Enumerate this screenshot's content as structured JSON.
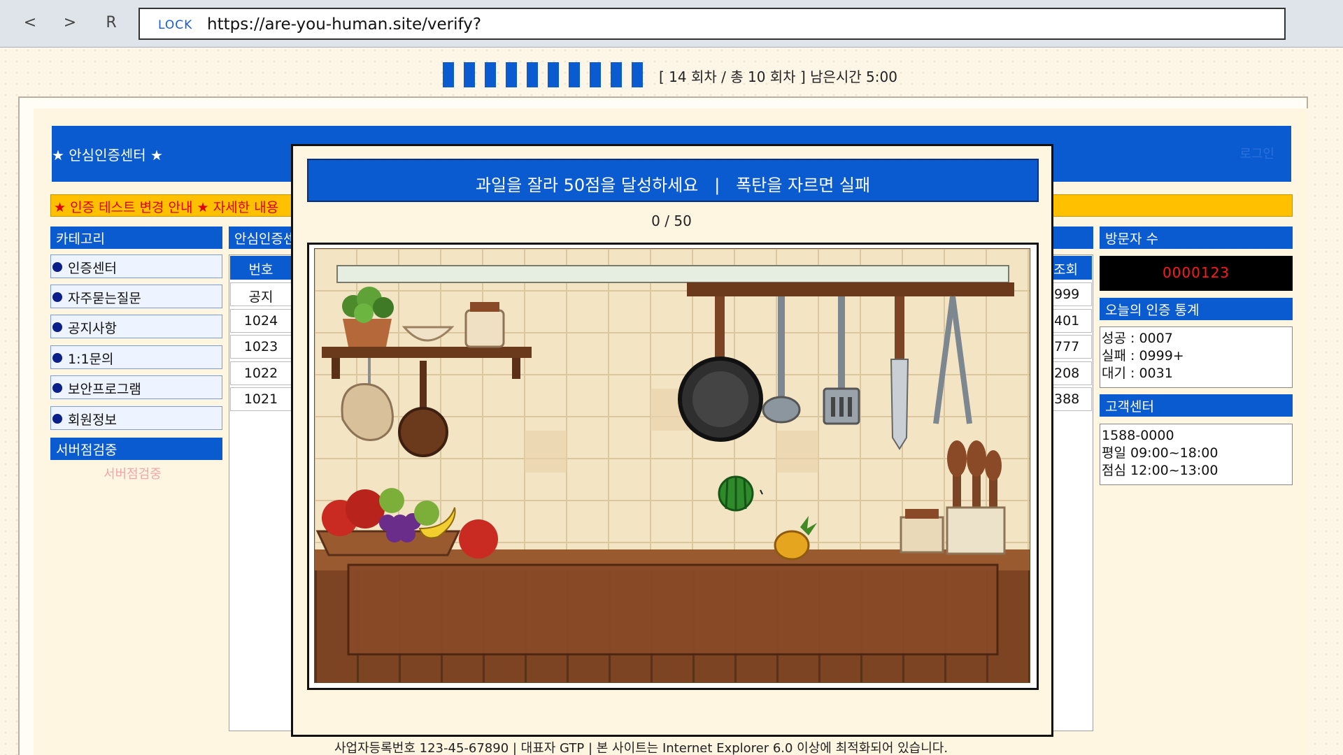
{
  "browser": {
    "back_icon": "<",
    "forward_icon": ">",
    "reload_icon": "R",
    "lock_label": "LOCK",
    "url": "https://are-you-human.site/verify?"
  },
  "progress": {
    "segments": 10,
    "text": "[ 14 회차 / 총 10 회차 ]  남은시간 5:00"
  },
  "site": {
    "logo": "★ 안심인증센터 ★",
    "login": "로그인",
    "ticker": "★ 인증 테스트 변경 안내 ★ 자세한 내용"
  },
  "left_sidebar": {
    "heading": "카테고리",
    "items": [
      {
        "label": "인증센터"
      },
      {
        "label": "자주묻는질문"
      },
      {
        "label": "공지사항"
      },
      {
        "label": "1:1문의"
      },
      {
        "label": "보안프로그램"
      },
      {
        "label": "회원정보"
      }
    ],
    "active": "서버점검중",
    "ghost": "서버점검중"
  },
  "board": {
    "heading": "안심인증센",
    "col_num": "번호",
    "rows": [
      {
        "num": "공지",
        "views": "999"
      },
      {
        "num": "1024",
        "views": "401"
      },
      {
        "num": "1023",
        "views": "777"
      },
      {
        "num": "1022",
        "views": "208"
      },
      {
        "num": "1021",
        "views": "388"
      }
    ],
    "col_views": "조회"
  },
  "right_sidebar": {
    "visitors_heading": "방문자 수",
    "visitors_count": "0000123",
    "stats_heading": "오늘의 인증 통계",
    "stats": [
      "성공  : 0007",
      "실패  : 0999+",
      "대기  : 0031"
    ],
    "support_heading": "고객센터",
    "support": [
      "1588-0000",
      "평일 09:00~18:00",
      "점심 12:00~13:00"
    ]
  },
  "footer": "사업자등록번호 123-45-67890 | 대표자 GTP | 본 사이트는 Internet Explorer 6.0 이상에 최적화되어 있습니다.",
  "modal": {
    "title": "과일을 잘라 50점을 달성하세요   |   폭탄을 자르면 실패",
    "score": "0 / 50",
    "colors": {
      "accent": "#0a5bd0",
      "wall": "#f1e2c2",
      "counter": "#8a4a28"
    }
  }
}
